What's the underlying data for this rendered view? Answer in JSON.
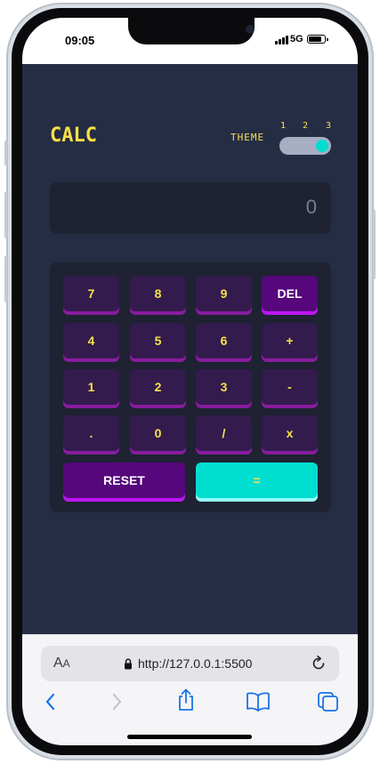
{
  "status_bar": {
    "time": "09:05",
    "network": "5G"
  },
  "app": {
    "title": "CALC",
    "theme_label": "THEME",
    "theme_options": [
      "1",
      "2",
      "3"
    ],
    "selected_theme": 3,
    "display_value": "0"
  },
  "keypad": {
    "row1": [
      "7",
      "8",
      "9",
      "DEL"
    ],
    "row2": [
      "4",
      "5",
      "6",
      "+"
    ],
    "row3": [
      "1",
      "2",
      "3",
      "-"
    ],
    "row4": [
      ".",
      "0",
      "/",
      "x"
    ],
    "reset": "RESET",
    "equals": "="
  },
  "browser": {
    "text_size_label": "A",
    "text_size_label_small": "A",
    "url": "http://127.0.0.1:5500"
  },
  "colors": {
    "app_bg": "#252d44",
    "panel_bg": "#1e2232",
    "accent_yellow": "#f8e049",
    "key_bg": "#331b4d",
    "key_shadow": "#881c9e",
    "special_key_bg": "#56077c",
    "equals_bg": "#00ded0"
  },
  "icons": [
    "lock-icon",
    "reload-icon",
    "back-icon",
    "forward-icon",
    "share-icon",
    "bookmarks-icon",
    "tabs-icon"
  ]
}
